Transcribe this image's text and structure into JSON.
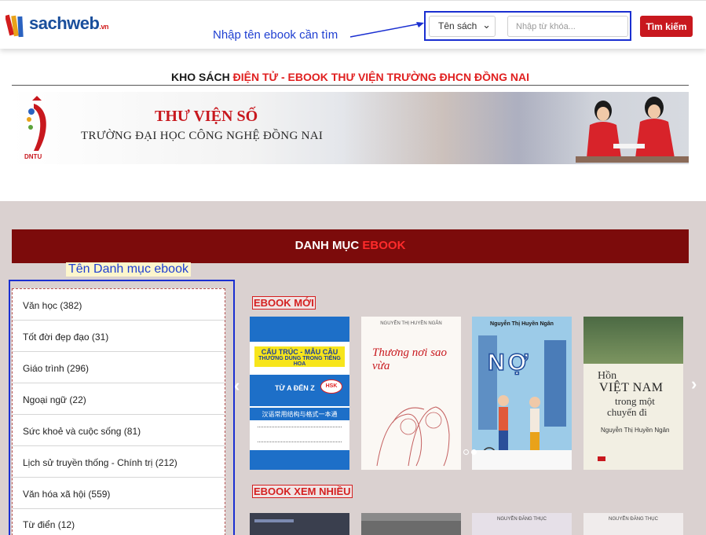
{
  "header": {
    "logo_main": "sachweb",
    "logo_suffix": ".vn",
    "search_annotation": "Nhập tên ebook cần tìm",
    "search_type_selected": "Tên sách",
    "keyword_placeholder": "Nhập từ khóa...",
    "search_button_label": "Tìm kiếm"
  },
  "kho": {
    "title_prefix": "KHO SÁCH",
    "title_highlight": "ĐIỆN TỬ - EBOOK THƯ VIỆN TRƯỜNG ĐHCN ĐỒNG NAI"
  },
  "banner": {
    "logo_text": "DNTU",
    "title": "THƯ VIỆN SỐ",
    "subtitle": "TRƯỜNG ĐẠI HỌC CÔNG NGHỆ ĐỒNG NAI"
  },
  "catalog": {
    "bar_prefix": "DANH MỤC",
    "bar_highlight": "EBOOK",
    "category_annotation": "Tên Danh mục ebook",
    "categories": [
      "Văn học (382)",
      "Tốt đời đẹp đạo (31)",
      "Giáo trình (296)",
      "Ngoại ngữ (22)",
      "Sức khoẻ và cuộc sống (81)",
      "Lịch sử truyền thống - Chính trị (212)",
      "Văn hóa xã hội (559)",
      "Từ điển (12)"
    ]
  },
  "sections": {
    "new_label": "EBOOK MỚI",
    "popular_label": "EBOOK XEM NHIỀU"
  },
  "books": {
    "b1": {
      "top": "CẤU TRÚC - MẪU CÂU",
      "mid": "THƯỜNG DÙNG TRONG TIẾNG HOA",
      "range": "TỪ A ĐẾN Z",
      "badge": "HSK",
      "chinese": "汉语常用结构与格式一本通"
    },
    "b2": {
      "author": "NGUYỄN THỊ HUYỀN NGÂN",
      "title": "Thương nơi sao vừa"
    },
    "b3": {
      "author": "Nguyễn Thị Huyền Ngân",
      "title": "NỢ"
    },
    "b4": {
      "line1": "Hồn",
      "line2": "VIỆT NAM",
      "line3": "trong một",
      "line4": "chuyến đi",
      "author": "Nguyễn Thị Huyền Ngân"
    },
    "thumb_author": "NGUYỄN ĐĂNG THỤC"
  },
  "colors": {
    "brand_red": "#c8181e",
    "dark_red_bar": "#7c0b0b",
    "annotation_blue": "#1a2fd1",
    "catalog_bg": "#dad1d0"
  }
}
